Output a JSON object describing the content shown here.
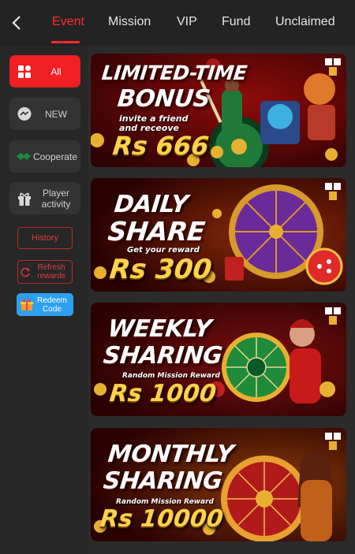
{
  "tabs": [
    "Event",
    "Mission",
    "VIP",
    "Fund",
    "Unclaimed"
  ],
  "sidebar": {
    "items": [
      {
        "label": "All",
        "icon": "grid-icon"
      },
      {
        "label": "NEW",
        "icon": "messenger-icon"
      },
      {
        "label": "Cooperate",
        "icon": "handshake-icon"
      },
      {
        "label": "Player activity",
        "icon": "gift-icon"
      }
    ],
    "history_label": "History",
    "refresh_label": "Refresh rewards",
    "redeem_label": "Redeem Code"
  },
  "banners": [
    {
      "line1": "LIMITED-TIME",
      "line2": "BONUS",
      "sub": "invite a friend and receove",
      "amount": "Rs 666"
    },
    {
      "line1": "DAILY",
      "line2": "SHARE",
      "sub": "Get your reward",
      "amount": "Rs 300"
    },
    {
      "line1": "WEEKLY",
      "line2": "SHARING",
      "sub": "Random Mission Reward",
      "amount": "Rs 1000"
    },
    {
      "line1": "MONTHLY",
      "line2": "SHARING",
      "sub": "Random Mission Reward",
      "amount": "Rs 10000"
    }
  ],
  "colors": {
    "accent": "#ef1f22",
    "gold": "#ffd24a",
    "banner_bg": "#3a0303"
  }
}
